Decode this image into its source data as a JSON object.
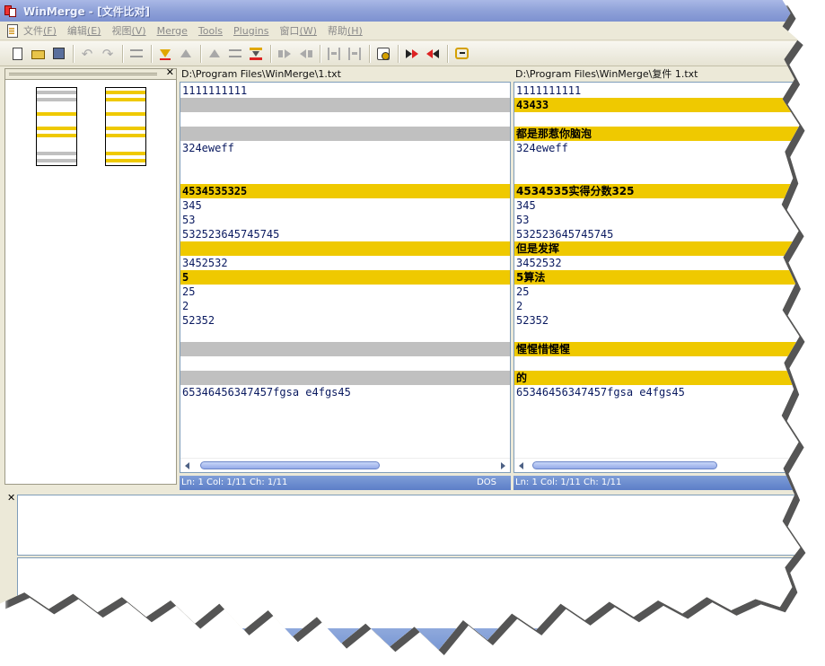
{
  "window": {
    "title": "WinMerge - [文件比对]"
  },
  "menu": [
    {
      "label": "文件",
      "key": "(F)"
    },
    {
      "label": "编辑",
      "key": "(E)"
    },
    {
      "label": "视图",
      "key": "(V)"
    },
    {
      "label": "Merge",
      "key": ""
    },
    {
      "label": "Tools",
      "key": ""
    },
    {
      "label": "Plugins",
      "key": ""
    },
    {
      "label": "窗口",
      "key": "(W)"
    },
    {
      "label": "帮助",
      "key": "(H)"
    }
  ],
  "left_pane": {
    "path": "D:\\Program Files\\WinMerge\\1.txt",
    "lines": [
      {
        "text": "1111111111",
        "kind": "normal"
      },
      {
        "text": "",
        "kind": "gap"
      },
      {
        "text": "",
        "kind": "blank"
      },
      {
        "text": "",
        "kind": "gap"
      },
      {
        "text": "324eweff",
        "kind": "normal"
      },
      {
        "text": "",
        "kind": "blank"
      },
      {
        "text": "",
        "kind": "blank"
      },
      {
        "text": "4534535325",
        "kind": "diff"
      },
      {
        "text": "345",
        "kind": "normal"
      },
      {
        "text": "53",
        "kind": "normal"
      },
      {
        "text": "532523645745745",
        "kind": "normal"
      },
      {
        "text": "",
        "kind": "diff"
      },
      {
        "text": "3452532",
        "kind": "normal"
      },
      {
        "text": "5",
        "kind": "diff"
      },
      {
        "text": "25",
        "kind": "normal"
      },
      {
        "text": "2",
        "kind": "normal"
      },
      {
        "text": "52352",
        "kind": "normal"
      },
      {
        "text": "",
        "kind": "blank"
      },
      {
        "text": "",
        "kind": "gap"
      },
      {
        "text": "",
        "kind": "blank"
      },
      {
        "text": "",
        "kind": "gap"
      },
      {
        "text": "65346456347457fgsa e4fgs45",
        "kind": "normal"
      }
    ],
    "status": "Ln: 1  Col: 1/11  Ch: 1/11",
    "eol": "DOS"
  },
  "right_pane": {
    "path": "D:\\Program Files\\WinMerge\\复件 1.txt",
    "lines": [
      {
        "text": "1111111111",
        "kind": "normal"
      },
      {
        "text": "43433",
        "kind": "diff"
      },
      {
        "text": "",
        "kind": "blank"
      },
      {
        "text": "都是那惹你脑泡",
        "kind": "diff"
      },
      {
        "text": "324eweff",
        "kind": "normal"
      },
      {
        "text": "",
        "kind": "blank"
      },
      {
        "text": "",
        "kind": "blank"
      },
      {
        "text": "4534535实得分数325",
        "kind": "diff"
      },
      {
        "text": "345",
        "kind": "normal"
      },
      {
        "text": "53",
        "kind": "normal"
      },
      {
        "text": "532523645745745",
        "kind": "normal"
      },
      {
        "text": "但是发挥",
        "kind": "diff"
      },
      {
        "text": "3452532",
        "kind": "normal"
      },
      {
        "text": "5算法",
        "kind": "diff"
      },
      {
        "text": "25",
        "kind": "normal"
      },
      {
        "text": "2",
        "kind": "normal"
      },
      {
        "text": "52352",
        "kind": "normal"
      },
      {
        "text": "",
        "kind": "blank"
      },
      {
        "text": "惺惺惜惺惺",
        "kind": "diff"
      },
      {
        "text": "",
        "kind": "blank"
      },
      {
        "text": "的",
        "kind": "diff"
      },
      {
        "text": "65346456347457fgsa e4fgs45",
        "kind": "normal"
      }
    ],
    "status": "Ln: 1  Col: 1/11  Ch: 1/11"
  },
  "colors": {
    "diff": "#efc900",
    "gap": "#c0c0c0"
  },
  "icons": [
    "new-file-icon",
    "open-folder-icon",
    "save-icon",
    "undo-icon",
    "redo-icon",
    "options-icon",
    "next-diff-icon",
    "prev-diff-icon",
    "first-diff-icon",
    "current-diff-icon",
    "last-diff-icon",
    "copy-right-icon",
    "copy-left-icon",
    "copy-all-right-icon",
    "copy-all-left-icon",
    "open-conflict-icon",
    "copy-right-advance-icon",
    "copy-left-advance-icon",
    "swap-panes-icon"
  ]
}
